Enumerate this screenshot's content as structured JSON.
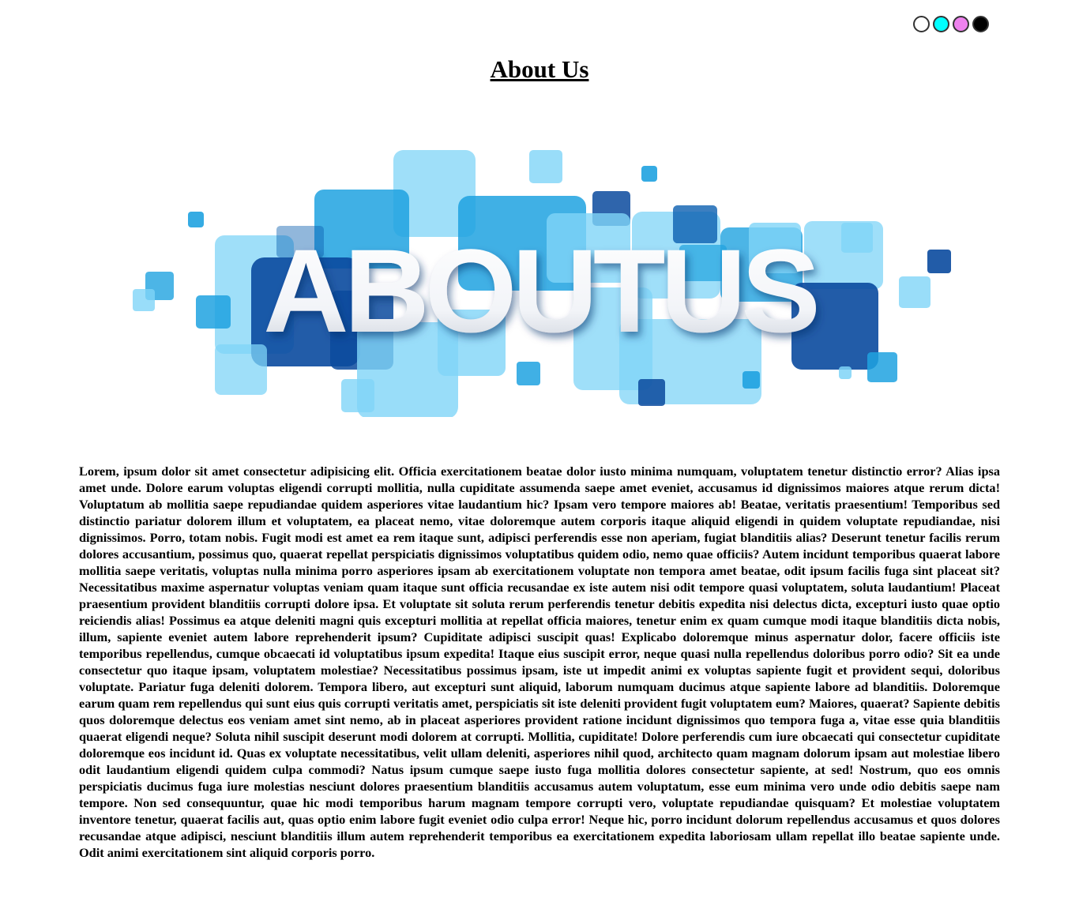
{
  "theme_options": [
    {
      "name": "white",
      "color": "#ffffff"
    },
    {
      "name": "cyan",
      "color": "#00ffff"
    },
    {
      "name": "violet",
      "color": "#ee82ee"
    },
    {
      "name": "black",
      "color": "#000000"
    }
  ],
  "page": {
    "title": "About Us"
  },
  "hero": {
    "text": "ABOUTUS"
  },
  "colors": {
    "light_blue": "#7fd4f7",
    "mid_blue": "#1fa2e0",
    "dark_blue": "#0b5fb0",
    "deep_blue": "#0a4a9e"
  },
  "body_text": "Lorem, ipsum dolor sit amet consectetur adipisicing elit. Officia exercitationem beatae dolor iusto minima numquam, voluptatem tenetur distinctio error? Alias ipsa amet unde. Dolore earum voluptas eligendi corrupti mollitia, nulla cupiditate assumenda saepe amet eveniet, accusamus id dignissimos maiores atque rerum dicta! Voluptatum ab mollitia saepe repudiandae quidem asperiores vitae laudantium hic? Ipsam vero tempore maiores ab! Beatae, veritatis praesentium! Temporibus sed distinctio pariatur dolorem illum et voluptatem, ea placeat nemo, vitae doloremque autem corporis itaque aliquid eligendi in quidem voluptate repudiandae, nisi dignissimos. Porro, totam nobis. Fugit modi est amet ea rem itaque sunt, adipisci perferendis esse non aperiam, fugiat blanditiis alias? Deserunt tenetur facilis rerum dolores accusantium, possimus quo, quaerat repellat perspiciatis dignissimos voluptatibus quidem odio, nemo quae officiis? Autem incidunt temporibus quaerat labore mollitia saepe veritatis, voluptas nulla minima porro asperiores ipsam ab exercitationem voluptate non tempora amet beatae, odit ipsum facilis fuga sint placeat sit? Necessitatibus maxime aspernatur voluptas veniam quam itaque sunt officia recusandae ex iste autem nisi odit tempore quasi voluptatem, soluta laudantium! Placeat praesentium provident blanditiis corrupti dolore ipsa. Et voluptate sit soluta rerum perferendis tenetur debitis expedita nisi delectus dicta, excepturi iusto quae optio reiciendis alias! Possimus ea atque deleniti magni quis excepturi mollitia at repellat officia maiores, tenetur enim ex quam cumque modi itaque blanditiis dicta nobis, illum, sapiente eveniet autem labore reprehenderit ipsum? Cupiditate adipisci suscipit quas! Explicabo doloremque minus aspernatur dolor, facere officiis iste temporibus repellendus, cumque obcaecati id voluptatibus ipsum expedita! Itaque eius suscipit error, neque quasi nulla repellendus doloribus porro odio? Sit ea unde consectetur quo itaque ipsam, voluptatem molestiae? Necessitatibus possimus ipsam, iste ut impedit animi ex voluptas sapiente fugit et provident sequi, doloribus voluptate. Pariatur fuga deleniti dolorem. Tempora libero, aut excepturi sunt aliquid, laborum numquam ducimus atque sapiente labore ad blanditiis. Doloremque earum quam rem repellendus qui sunt eius quis corrupti veritatis amet, perspiciatis sit iste deleniti provident fugit voluptatem eum? Maiores, quaerat? Sapiente debitis quos doloremque delectus eos veniam amet sint nemo, ab in placeat asperiores provident ratione incidunt dignissimos quo tempora fuga a, vitae esse quia blanditiis quaerat eligendi neque? Soluta nihil suscipit deserunt modi dolorem at corrupti. Mollitia, cupiditate! Dolore perferendis cum iure obcaecati qui consectetur cupiditate doloremque eos incidunt id. Quas ex voluptate necessitatibus, velit ullam deleniti, asperiores nihil quod, architecto quam magnam dolorum ipsam aut molestiae libero odit laudantium eligendi quidem culpa commodi? Natus ipsum cumque saepe iusto fuga mollitia dolores consectetur sapiente, at sed! Nostrum, quo eos omnis perspiciatis ducimus fuga iure molestias nesciunt dolores praesentium blanditiis accusamus autem voluptatum, esse eum minima vero unde odio debitis saepe nam tempore. Non sed consequuntur, quae hic modi temporibus harum magnam tempore corrupti vero, voluptate repudiandae quisquam? Et molestiae voluptatem inventore tenetur, quaerat facilis aut, quas optio enim labore fugit eveniet odio culpa error! Neque hic, porro incidunt dolorum repellendus accusamus et quos dolores recusandae atque adipisci, nesciunt blanditiis illum autem reprehenderit temporibus ea exercitationem expedita laboriosam ullam repellat illo beatae sapiente unde. Odit animi exercitationem sint aliquid corporis porro."
}
